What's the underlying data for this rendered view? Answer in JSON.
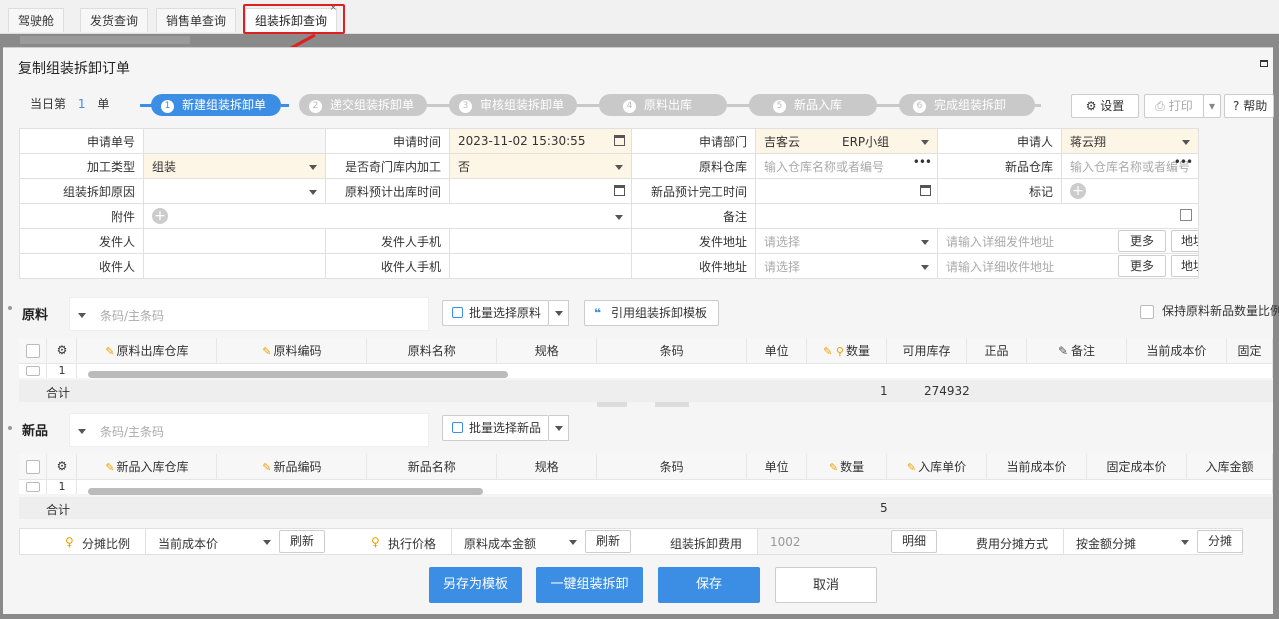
{
  "tabs": [
    "驾驶舱",
    "发货查询",
    "销售单查询",
    "组装拆卸查询"
  ],
  "tab_close": "×",
  "modal": {
    "title": "复制组装拆卸订单"
  },
  "today": {
    "prefix": "当日第",
    "count": "1",
    "suffix": "单"
  },
  "steps": [
    {
      "num": "1",
      "label": "新建组装拆卸单"
    },
    {
      "num": "2",
      "label": "递交组装拆卸单"
    },
    {
      "num": "3",
      "label": "审核组装拆卸单"
    },
    {
      "num": "4",
      "label": "原料出库"
    },
    {
      "num": "5",
      "label": "新品入库"
    },
    {
      "num": "6",
      "label": "完成组装拆卸"
    }
  ],
  "toolbar": {
    "settings": "设置",
    "print": "打印",
    "help": "帮助"
  },
  "form": {
    "apply_no_label": "申请单号",
    "apply_no": "",
    "apply_time_label": "申请时间",
    "apply_time": "2023-11-02 15:30:55",
    "dept_label": "申请部门",
    "dept_a": "吉客云",
    "dept_b": "ERP小组",
    "applicant_label": "申请人",
    "applicant": "蒋云翔",
    "proc_type_label": "加工类型",
    "proc_type": "组装",
    "cross_dept_label": "是否奇门库内加工",
    "cross_dept": "否",
    "raw_wh_label": "原料仓库",
    "raw_wh_ph": "输入仓库名称或者编号",
    "new_wh_label": "新品仓库",
    "new_wh_ph": "输入仓库名称或者编号",
    "reason_label": "组装拆卸原因",
    "raw_out_time_label": "原料预计出库时间",
    "new_done_time_label": "新品预计完工时间",
    "mark_label": "标记",
    "attach_label": "附件",
    "remark_label": "备注",
    "sender_label": "发件人",
    "sender_phone_label": "发件人手机",
    "sender_addr_label": "发件地址",
    "receiver_label": "收件人",
    "receiver_phone_label": "收件人手机",
    "receiver_addr_label": "收件地址",
    "select_ph": "请选择",
    "send_detail_ph": "请输入详细发件地址",
    "recv_detail_ph": "请输入详细收件地址",
    "more": "更多",
    "parse": "地址解析"
  },
  "raw": {
    "title": "原料",
    "search_ph": "条码/主条码",
    "batch_btn": "批量选择原料",
    "template_btn": "引用组装拆卸模板",
    "keep_ratio": "保持原料新品数量比例",
    "columns": [
      "原料出库仓库",
      "原料编码",
      "原料名称",
      "规格",
      "条码",
      "单位",
      "数量",
      "可用库存",
      "正品",
      "备注",
      "当前成本价",
      "固定"
    ],
    "row_index": "1",
    "total_label": "合计",
    "total_qty": "1",
    "total_stock": "274932"
  },
  "new": {
    "title": "新品",
    "search_ph": "条码/主条码",
    "batch_btn": "批量选择新品",
    "columns": [
      "新品入库仓库",
      "新品编码",
      "新品名称",
      "规格",
      "条码",
      "单位",
      "数量",
      "入库单价",
      "当前成本价",
      "固定成本价",
      "入库金额"
    ],
    "row_index": "1",
    "total_label": "合计",
    "total_qty": "5"
  },
  "alloc": {
    "ratio_label": "分摊比例",
    "ratio_value": "当前成本价",
    "refresh": "刷新",
    "exec_label": "执行价格",
    "exec_value": "原料成本金额",
    "fee_label": "组装拆卸费用",
    "fee_value": "1002",
    "detail": "明细",
    "method_label": "费用分摊方式",
    "method_value": "按金额分摊",
    "split": "分摊"
  },
  "actions": {
    "save_template": "另存为模板",
    "one_click": "一键组装拆卸",
    "save": "保存",
    "cancel": "取消"
  },
  "colors": {
    "accent": "#3c8ee4",
    "highlight": "#e02020",
    "required_bg": "#fdf5e6"
  }
}
